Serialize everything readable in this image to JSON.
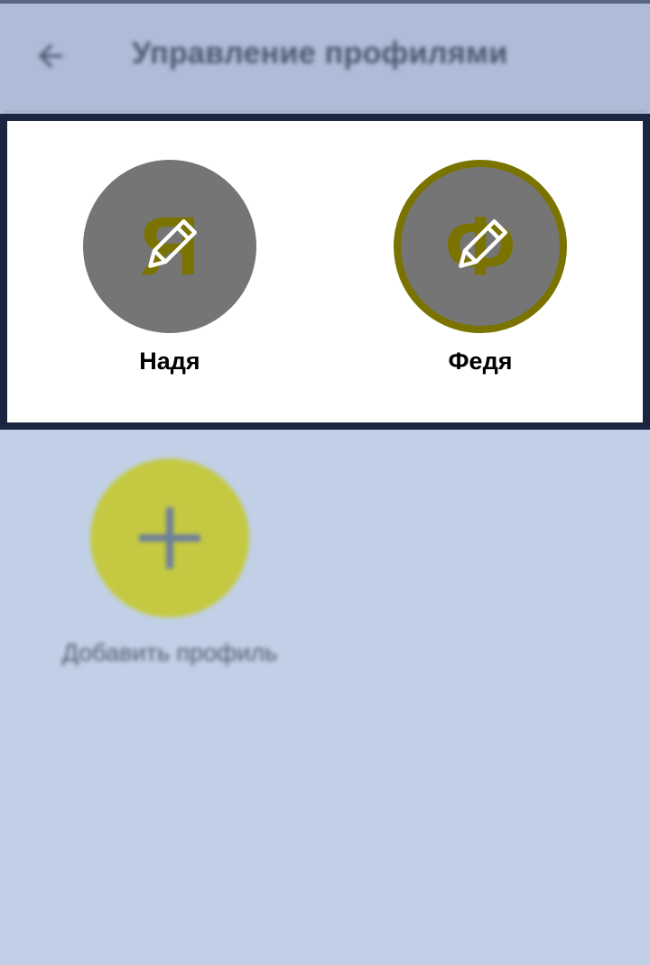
{
  "app_bar": {
    "title": "Управление профилями",
    "back_icon": "arrow-left-icon"
  },
  "profiles": [
    {
      "name": "Надя",
      "avatar_letter": "Я",
      "selected": false,
      "edit_icon": "pencil-icon"
    },
    {
      "name": "Федя",
      "avatar_letter": "Ф",
      "selected": true,
      "edit_icon": "pencil-icon"
    }
  ],
  "add_profile": {
    "label": "Добавить профиль",
    "icon": "plus-icon"
  },
  "colors": {
    "background": "#c1d0e6",
    "app_bar": "#aebcd8",
    "panel_border": "#1b2440",
    "avatar": "#757575",
    "avatar_accent": "#7b7300",
    "add_button": "#c4c941"
  }
}
